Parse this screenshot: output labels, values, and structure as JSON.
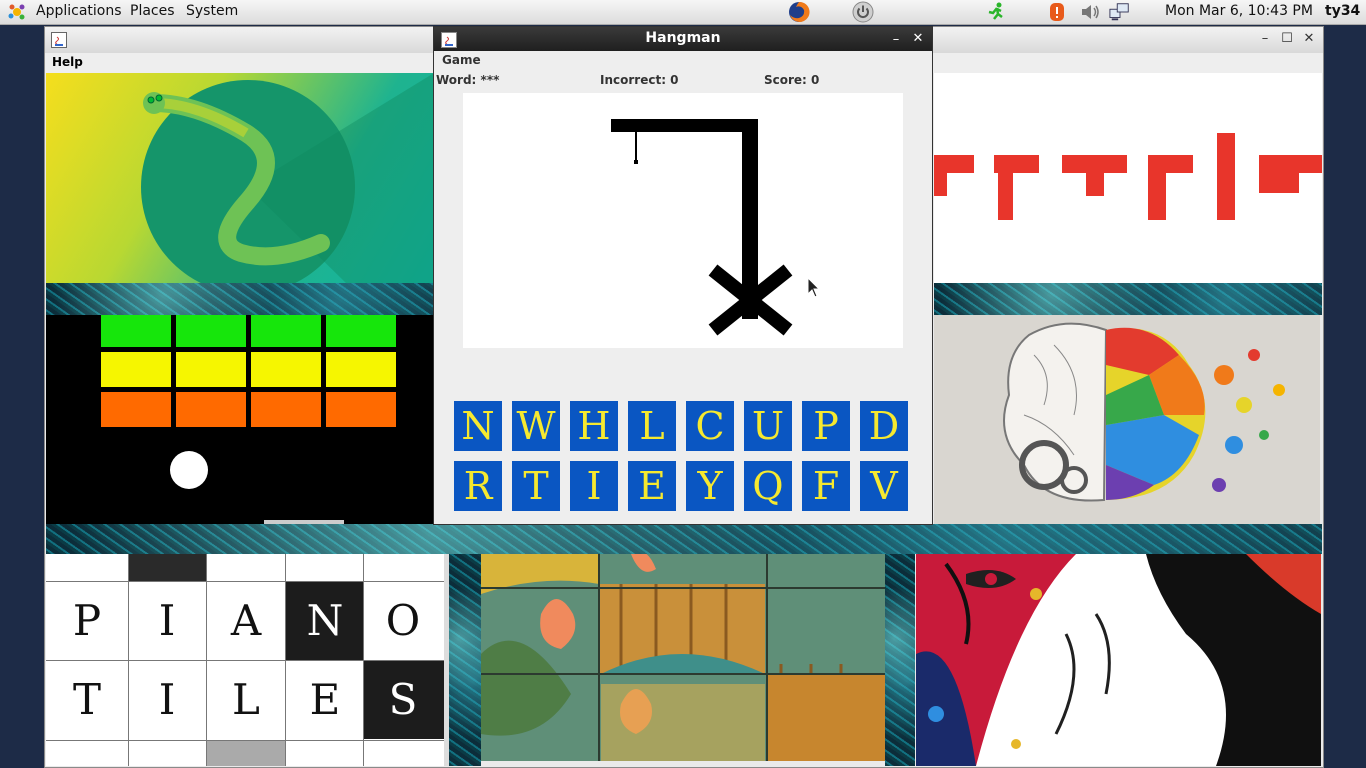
{
  "top_panel": {
    "menus": [
      "Applications",
      "Places",
      "System"
    ],
    "clock": "Mon Mar  6, 10:43 PM",
    "user": "ty34"
  },
  "main_window": {
    "menu": [
      "Help"
    ]
  },
  "tiles": {
    "piano": {
      "rows": [
        [
          "P",
          "I",
          "A",
          "N",
          "O"
        ],
        [
          "T",
          "I",
          "L",
          "E",
          "S"
        ]
      ]
    }
  },
  "hangman": {
    "title": "Hangman",
    "menu": [
      "Game"
    ],
    "word": "Word: ***",
    "incorrect": "Incorrect: 0",
    "score": "Score: 0",
    "letters_row1": [
      "N",
      "W",
      "H",
      "L",
      "C",
      "U",
      "P",
      "D"
    ],
    "letters_row2": [
      "R",
      "T",
      "I",
      "E",
      "Y",
      "Q",
      "F",
      "V"
    ],
    "button_color": "#0a56c2",
    "letter_color": "#f6e92f"
  },
  "colors": {
    "tetris_red": "#e8352b",
    "brick_green": "#16e60b",
    "brick_yellow": "#f6f600",
    "brick_orange": "#ff6a00"
  }
}
